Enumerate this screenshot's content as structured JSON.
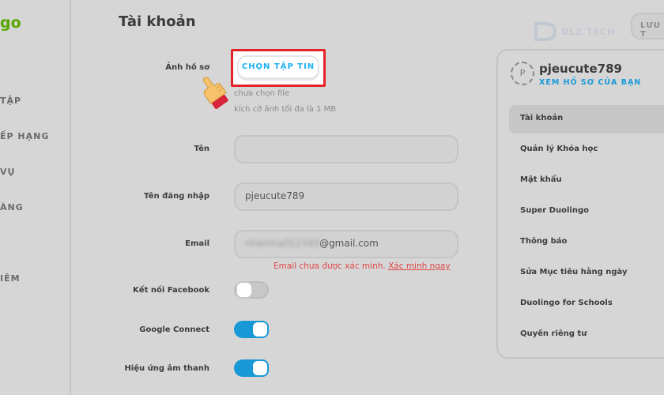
{
  "sidebar": {
    "logo": "go",
    "items": [
      {
        "label": "TẬP"
      },
      {
        "label": "ẾP HẠNG"
      },
      {
        "label": "VỤ"
      },
      {
        "label": "ÀNG"
      },
      {
        "label": "IÊM"
      }
    ]
  },
  "header": {
    "title": "Tài khoản",
    "save_label": "LƯU T"
  },
  "watermark": {
    "text": "DLZ TECH"
  },
  "form": {
    "avatar_label": "Ảnh hồ sơ",
    "choose_file_label": "CHỌN TẬP TIN",
    "no_file_text": "chưa chọn file",
    "max_size_text": "kích cỡ ảnh tối đa là 1 MB",
    "name_label": "Tên",
    "name_value": "",
    "username_label": "Tên đăng nhập",
    "username_value": "pjeucute789",
    "email_label": "Email",
    "email_hidden": "nhanmail12345",
    "email_domain": "@gmail.com",
    "email_error": "Email chưa được xác minh.",
    "email_verify_link": "Xác minh ngay",
    "facebook_label": "Kết nối Facebook",
    "facebook_on": false,
    "google_label": "Google Connect",
    "google_on": true,
    "sound_label": "Hiệu ứng âm thanh",
    "sound_on": true
  },
  "profile": {
    "avatar_letter": "P",
    "username": "pjeucute789",
    "view_profile": "XEM HỒ SƠ CỦA BẠN",
    "menu": [
      {
        "label": "Tài khoản",
        "active": true
      },
      {
        "label": "Quản lý Khóa học"
      },
      {
        "label": "Mật khẩu"
      },
      {
        "label": "Super Duolingo"
      },
      {
        "label": "Thông báo"
      },
      {
        "label": "Sửa Mục tiêu hằng ngày"
      },
      {
        "label": "Duolingo for Schools"
      },
      {
        "label": "Quyền riêng tư"
      }
    ]
  },
  "colors": {
    "accent_blue": "#1899d6",
    "link_blue": "#1cb0f6",
    "logo_green": "#58a700",
    "error_red": "#e04848",
    "highlight_red": "#e2232a"
  },
  "icons": {
    "hand": "pointing-hand-icon"
  }
}
